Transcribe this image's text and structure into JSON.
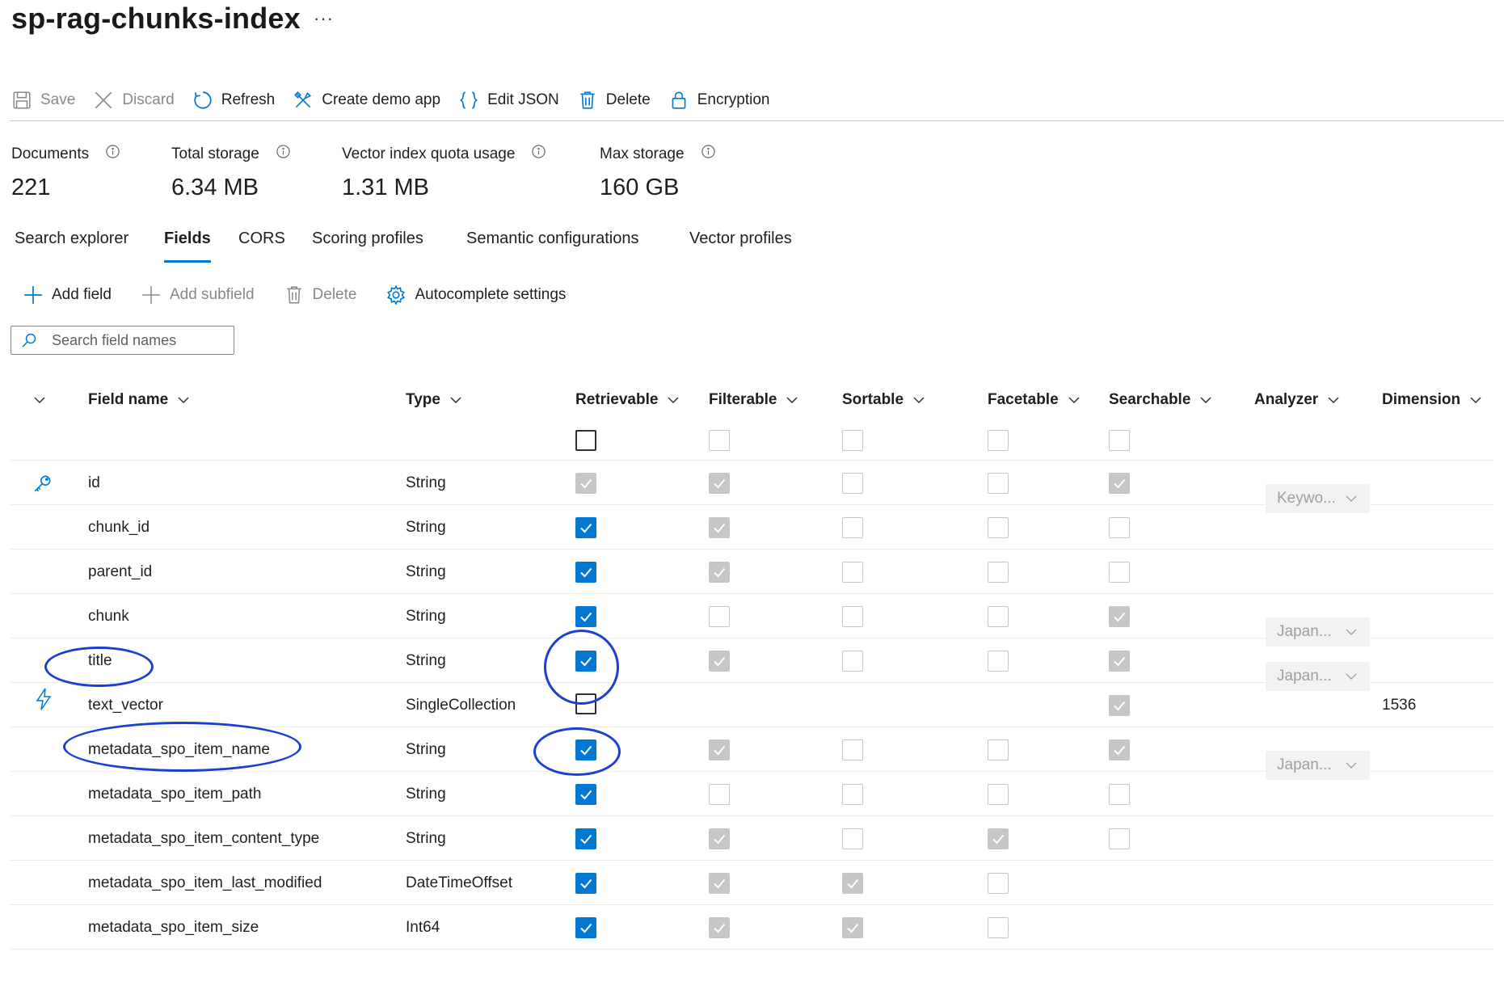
{
  "page": {
    "title": "sp-rag-chunks-index",
    "more": "···"
  },
  "toolbar": [
    {
      "label": "Save",
      "icon": "save-icon",
      "disabled": true
    },
    {
      "label": "Discard",
      "icon": "close-icon",
      "disabled": true
    },
    {
      "label": "Refresh",
      "icon": "refresh-icon",
      "disabled": false
    },
    {
      "label": "Create demo app",
      "icon": "tools-icon",
      "disabled": false
    },
    {
      "label": "Edit JSON",
      "icon": "braces-icon",
      "disabled": false
    },
    {
      "label": "Delete",
      "icon": "trash-icon",
      "disabled": false
    },
    {
      "label": "Encryption",
      "icon": "lock-icon",
      "disabled": false
    }
  ],
  "stats": [
    {
      "label": "Documents",
      "value": "221"
    },
    {
      "label": "Total storage",
      "value": "6.34 MB"
    },
    {
      "label": "Vector index quota usage",
      "value": "1.31 MB"
    },
    {
      "label": "Max storage",
      "value": "160 GB"
    }
  ],
  "tabs": [
    {
      "label": "Search explorer",
      "active": false
    },
    {
      "label": "Fields",
      "active": true
    },
    {
      "label": "CORS",
      "active": false
    },
    {
      "label": "Scoring profiles",
      "active": false
    },
    {
      "label": "Semantic configurations",
      "active": false
    },
    {
      "label": "Vector profiles",
      "active": false
    }
  ],
  "fieldsToolbar": [
    {
      "label": "Add field",
      "icon": "plus-icon",
      "disabled": false
    },
    {
      "label": "Add subfield",
      "icon": "plus-icon",
      "disabled": true
    },
    {
      "label": "Delete",
      "icon": "trash-icon",
      "disabled": true
    },
    {
      "label": "Autocomplete settings",
      "icon": "gear-icon",
      "disabled": false
    }
  ],
  "search": {
    "placeholder": "Search field names",
    "value": ""
  },
  "table": {
    "columns": [
      "Field name",
      "Type",
      "Retrievable",
      "Filterable",
      "Sortable",
      "Facetable",
      "Searchable",
      "Analyzer",
      "Dimension"
    ],
    "headerCheckboxes": [
      "empty-strong",
      "empty",
      "empty",
      "empty",
      "empty"
    ],
    "rows": [
      {
        "icon": "key-icon",
        "name": "id",
        "type": "String",
        "checks": [
          "dis",
          "dis",
          "empty",
          "empty",
          "dis"
        ],
        "analyzer": "Keywo...",
        "dimension": ""
      },
      {
        "icon": "",
        "name": "chunk_id",
        "type": "String",
        "checks": [
          "on",
          "dis",
          "empty",
          "empty",
          "empty"
        ],
        "analyzer": "",
        "dimension": ""
      },
      {
        "icon": "",
        "name": "parent_id",
        "type": "String",
        "checks": [
          "on",
          "dis",
          "empty",
          "empty",
          "empty"
        ],
        "analyzer": "",
        "dimension": ""
      },
      {
        "icon": "",
        "name": "chunk",
        "type": "String",
        "checks": [
          "on",
          "empty",
          "empty",
          "empty",
          "dis"
        ],
        "analyzer": "Japan...",
        "dimension": ""
      },
      {
        "icon": "",
        "name": "title",
        "type": "String",
        "checks": [
          "on",
          "dis",
          "empty",
          "empty",
          "dis"
        ],
        "analyzer": "Japan...",
        "dimension": ""
      },
      {
        "icon": "bolt-icon",
        "name": "text_vector",
        "type": "SingleCollection",
        "checks": [
          "empty-strong",
          "none",
          "none",
          "none",
          "dis"
        ],
        "analyzer": "",
        "dimension": "1536"
      },
      {
        "icon": "",
        "name": "metadata_spo_item_name",
        "type": "String",
        "checks": [
          "on",
          "dis",
          "empty",
          "empty",
          "dis"
        ],
        "analyzer": "Japan...",
        "dimension": ""
      },
      {
        "icon": "",
        "name": "metadata_spo_item_path",
        "type": "String",
        "checks": [
          "on",
          "empty",
          "empty",
          "empty",
          "empty"
        ],
        "analyzer": "",
        "dimension": ""
      },
      {
        "icon": "",
        "name": "metadata_spo_item_content_type",
        "type": "String",
        "checks": [
          "on",
          "dis",
          "empty",
          "dis",
          "empty"
        ],
        "analyzer": "",
        "dimension": ""
      },
      {
        "icon": "",
        "name": "metadata_spo_item_last_modified",
        "type": "DateTimeOffset",
        "checks": [
          "on",
          "dis",
          "dis",
          "empty",
          "none"
        ],
        "analyzer": "",
        "dimension": ""
      },
      {
        "icon": "",
        "name": "metadata_spo_item_size",
        "type": "Int64",
        "checks": [
          "on",
          "dis",
          "dis",
          "empty",
          "none"
        ],
        "analyzer": "",
        "dimension": ""
      }
    ]
  },
  "colors": {
    "accent": "#0078d4",
    "annotation": "#1b3fd1",
    "disabled": "#c8c6c4"
  }
}
